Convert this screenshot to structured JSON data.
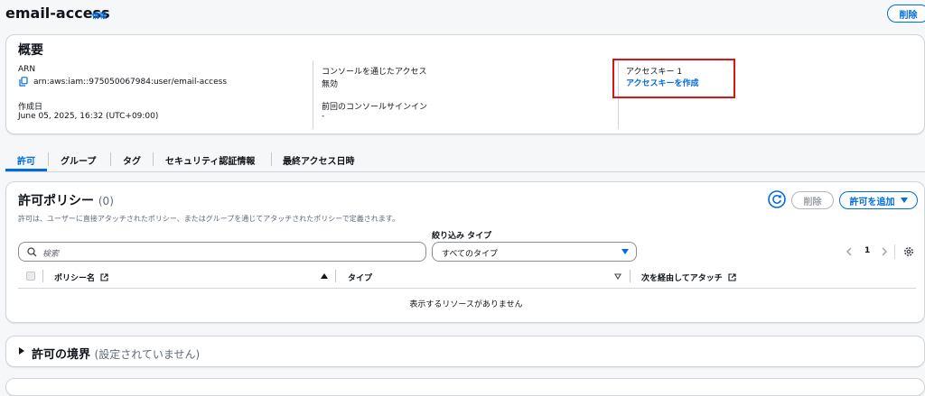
{
  "page": {
    "title": "email-access",
    "info_label": "情報",
    "delete_label": "削除"
  },
  "overview": {
    "heading": "概要",
    "arn_label": "ARN",
    "arn_value": "arn:aws:iam::975050067984:user/email-access",
    "created_label": "作成日",
    "created_value": "June 05, 2025, 16:32 (UTC+09:00)",
    "console_access_label": "コンソールを通じたアクセス",
    "console_access_value": "無効",
    "last_signin_label": "前回のコンソールサインイン",
    "last_signin_value": "-",
    "access_key_label": "アクセスキー 1",
    "access_key_link": "アクセスキーを作成",
    "highlight_color": "#d91515"
  },
  "tabs": [
    {
      "label": "許可",
      "active": true
    },
    {
      "label": "グループ",
      "active": false
    },
    {
      "label": "タグ",
      "active": false
    },
    {
      "label": "セキュリティ認証情報",
      "active": false
    },
    {
      "label": "最終アクセス日時",
      "active": false
    }
  ],
  "policies": {
    "heading": "許可ポリシー",
    "count": "(0)",
    "description": "許可は、ユーザーに直接アタッチされたポリシー、またはグループを通じてアタッチされたポリシーで定義されます。",
    "refresh_icon": "refresh-icon",
    "delete_label": "削除",
    "add_label": "許可を追加",
    "search_placeholder": "検索",
    "filter_label": "絞り込み タイプ",
    "filter_value": "すべてのタイプ",
    "page_number": "1",
    "columns": [
      "ポリシー名",
      "タイプ",
      "次を経由してアタッチ"
    ],
    "empty_message": "表示するリソースがありません"
  },
  "boundary": {
    "heading": "許可の境界",
    "status": "(設定されていません)"
  },
  "colors": {
    "accent": "#006ce0",
    "border": "#d1d5db",
    "background": "#f6f7f9"
  }
}
